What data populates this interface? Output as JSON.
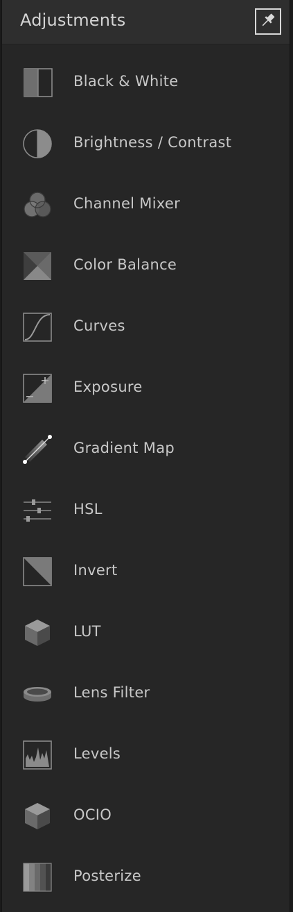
{
  "panel": {
    "title": "Adjustments",
    "pin_icon": "pin-icon"
  },
  "items": [
    {
      "label": "Black & White",
      "icon": "black-white-icon"
    },
    {
      "label": "Brightness / Contrast",
      "icon": "brightness-contrast-icon"
    },
    {
      "label": "Channel Mixer",
      "icon": "channel-mixer-icon"
    },
    {
      "label": "Color Balance",
      "icon": "color-balance-icon"
    },
    {
      "label": "Curves",
      "icon": "curves-icon"
    },
    {
      "label": "Exposure",
      "icon": "exposure-icon"
    },
    {
      "label": "Gradient Map",
      "icon": "gradient-map-icon"
    },
    {
      "label": "HSL",
      "icon": "hsl-icon"
    },
    {
      "label": "Invert",
      "icon": "invert-icon"
    },
    {
      "label": "LUT",
      "icon": "lut-cube-icon"
    },
    {
      "label": "Lens Filter",
      "icon": "lens-filter-icon"
    },
    {
      "label": "Levels",
      "icon": "levels-icon"
    },
    {
      "label": "OCIO",
      "icon": "ocio-cube-icon"
    },
    {
      "label": "Posterize",
      "icon": "posterize-icon"
    }
  ],
  "colors": {
    "background": "#262626",
    "header": "#2e2e2e",
    "text": "#c8c8c8",
    "icon_fill": "#6e6e6e",
    "icon_stroke": "#8a8a8a"
  }
}
